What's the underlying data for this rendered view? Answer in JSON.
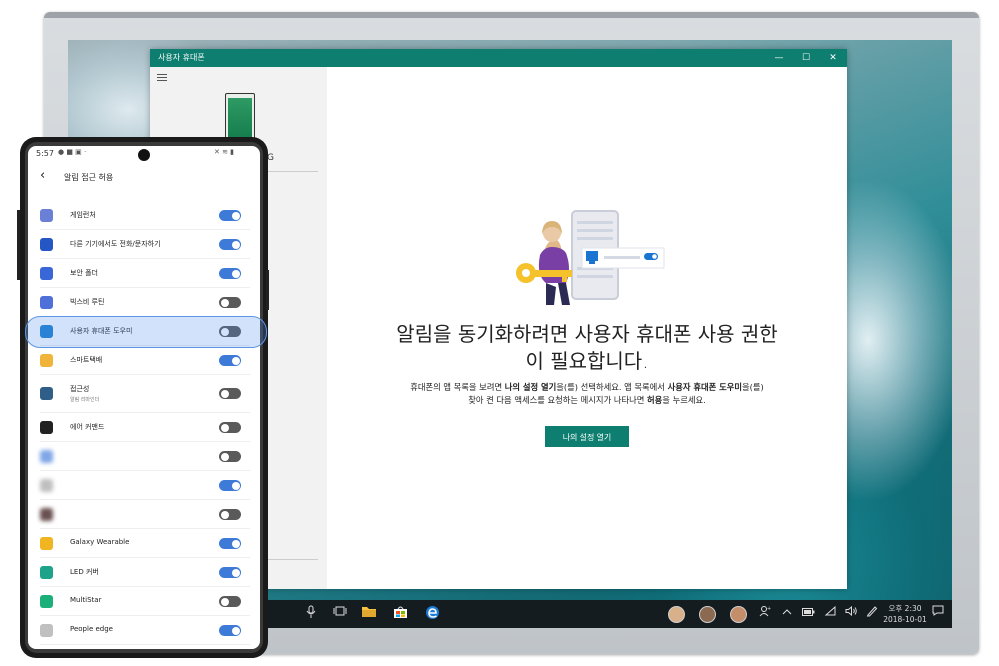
{
  "app": {
    "title": "사용자 휴대폰",
    "window_controls": {
      "minimize": "—",
      "maximize": "☐",
      "close": "✕"
    },
    "sidebar_device_label": "G",
    "heading_line1": "알림을 동기화하려면 사용자 휴대폰 사용 권한",
    "heading_line2": "이 필요합니다.",
    "desc": {
      "p1": "휴대폰의 앱 목록을 보려면 ",
      "b1": "나의 설정 열기",
      "p2": "을(를) 선택하세요. 앱 목록에서 ",
      "b2": "사용자 휴대폰 도우미",
      "p3": "을(를)",
      "line2a": "찾아 켠 다음 액세스를 요청하는 메시지가 나타나면 ",
      "b3": "허용",
      "line2b": "을 누르세요."
    },
    "button_label": "나의 설정 열기",
    "accent": "#0d7e6f"
  },
  "taskbar": {
    "time": "오후 2:30",
    "date": "2018-10-01",
    "icons": [
      "mic-icon",
      "task-view-icon",
      "file-explorer-icon",
      "store-icon",
      "edge-icon",
      "people-icon",
      "chevron-up-icon",
      "battery-icon",
      "wifi-icon",
      "volume-icon",
      "pen-icon",
      "notification-icon"
    ]
  },
  "phone": {
    "status_time": "5:57",
    "title": "알림 접근 허용",
    "items": [
      {
        "label": "게임런처",
        "on": true,
        "color": "#6a7fd6"
      },
      {
        "label": "다른 기기에서도 전화/문자하기",
        "on": true,
        "color": "#2457c5"
      },
      {
        "label": "보안 폴더",
        "on": true,
        "color": "#3a67d8"
      },
      {
        "label": "빅스비 루틴",
        "on": false,
        "color": "#4f70d9"
      },
      {
        "label": "사용자 휴대폰 도우미",
        "on": false,
        "color": "#1f7fd1"
      },
      {
        "label": "스마트택배",
        "on": true,
        "color": "#f0b43a"
      },
      {
        "label": "접근성",
        "sub": "알림 리마인더",
        "on": false,
        "color": "#2f5f88"
      },
      {
        "label": "에어 커맨드",
        "on": false,
        "color": "#222222"
      },
      {
        "label": "",
        "on": false,
        "color": "#7fa6e6",
        "blurred": true
      },
      {
        "label": "",
        "on": true,
        "color": "#bfbfbf",
        "blurred": true
      },
      {
        "label": "",
        "on": false,
        "color": "#6a5050",
        "blurred": true
      },
      {
        "label": "Galaxy Wearable",
        "on": true,
        "color": "#f1b522"
      },
      {
        "label": "LED 커버",
        "on": true,
        "color": "#1da38a"
      },
      {
        "label": "MultiStar",
        "on": false,
        "color": "#1bb07a"
      },
      {
        "label": "People edge",
        "on": true,
        "color": "#c0c0c0"
      }
    ]
  }
}
